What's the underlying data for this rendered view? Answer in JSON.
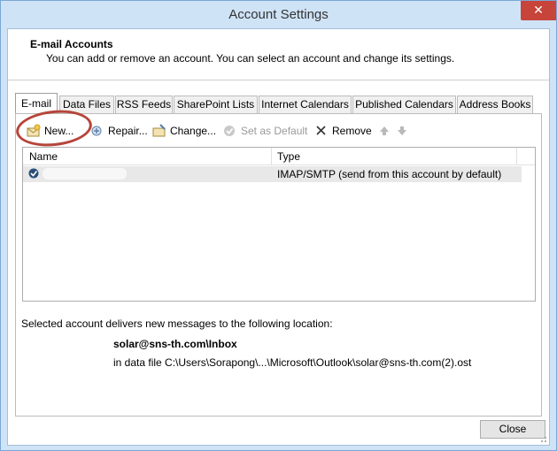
{
  "window": {
    "title": "Account Settings",
    "close_glyph": "✕"
  },
  "header": {
    "title": "E-mail Accounts",
    "description": "You can add or remove an account. You can select an account and change its settings."
  },
  "tabs": [
    {
      "label": "E-mail",
      "active": true
    },
    {
      "label": "Data Files"
    },
    {
      "label": "RSS Feeds"
    },
    {
      "label": "SharePoint Lists"
    },
    {
      "label": "Internet Calendars"
    },
    {
      "label": "Published Calendars"
    },
    {
      "label": "Address Books"
    }
  ],
  "toolbar": {
    "new_label": "New...",
    "repair_label": "Repair...",
    "change_label": "Change...",
    "set_default_label": "Set as Default",
    "remove_label": "Remove"
  },
  "list": {
    "columns": {
      "name": "Name",
      "type": "Type"
    },
    "rows": [
      {
        "name": "",
        "type": "IMAP/SMTP (send from this account by default)"
      }
    ]
  },
  "delivery": {
    "intro": "Selected account delivers new messages to the following location:",
    "location": "solar@sns-th.com\\Inbox",
    "data_file": "in data file C:\\Users\\Sorapong\\...\\Microsoft\\Outlook\\solar@sns-th.com(2).ost"
  },
  "buttons": {
    "close_label": "Close"
  },
  "colors": {
    "accent_callout": "#b6453a",
    "titlebar": "#cfe3f7",
    "close_button": "#c7443b"
  }
}
